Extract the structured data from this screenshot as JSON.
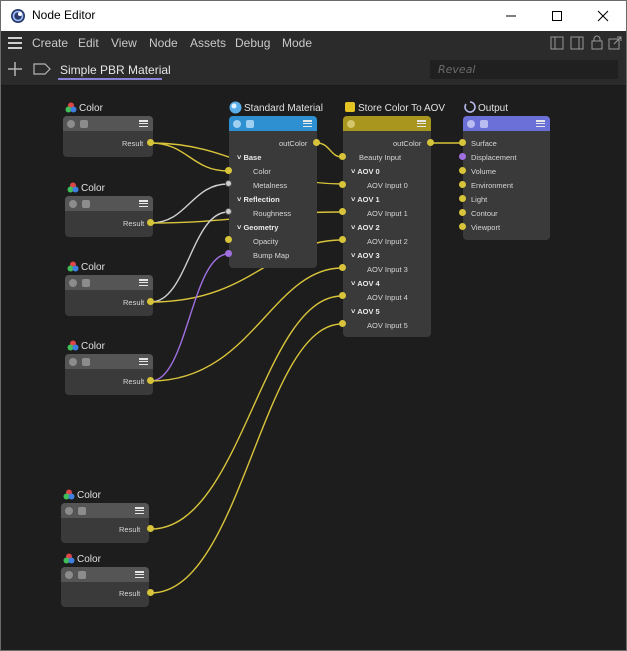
{
  "window": {
    "title": "Node Editor"
  },
  "menu": [
    "Create",
    "Edit",
    "View",
    "Node",
    "Assets",
    "Debug",
    "Mode"
  ],
  "tab": {
    "label": "Simple PBR Material"
  },
  "search": {
    "placeholder": "Reveal"
  },
  "colors": {
    "accent": "#8b84d6",
    "wire": "#d8c43a",
    "wire_light": "#c8c8c8",
    "wire_purple": "#a070e0",
    "standard_material": "#2e8fd1",
    "aov": "#a9961e",
    "output": "#6b6fd8"
  },
  "color_node": {
    "title": "Color",
    "output": "Result"
  },
  "standard_material": {
    "title": "Standard Material",
    "output": "outColor",
    "rows": [
      {
        "label": "Base",
        "group": true
      },
      {
        "label": "Color"
      },
      {
        "label": "Metalness"
      },
      {
        "label": "Reflection",
        "group": true
      },
      {
        "label": "Roughness"
      },
      {
        "label": "Geometry",
        "group": true
      },
      {
        "label": "Opacity"
      },
      {
        "label": "Bump Map"
      }
    ]
  },
  "store_color": {
    "title": "Store Color To AOV",
    "output": "outColor",
    "rows": [
      {
        "label": "Beauty Input"
      },
      {
        "label": "AOV 0",
        "group": true
      },
      {
        "label": "AOV Input 0"
      },
      {
        "label": "AOV 1",
        "group": true
      },
      {
        "label": "AOV Input 1"
      },
      {
        "label": "AOV 2",
        "group": true
      },
      {
        "label": "AOV Input 2"
      },
      {
        "label": "AOV 3",
        "group": true
      },
      {
        "label": "AOV Input 3"
      },
      {
        "label": "AOV 4",
        "group": true
      },
      {
        "label": "AOV Input 4"
      },
      {
        "label": "AOV 5",
        "group": true
      },
      {
        "label": "AOV Input 5"
      }
    ]
  },
  "output_node": {
    "title": "Output",
    "inputs": [
      "Surface",
      "Displacement",
      "Volume",
      "Environment",
      "Light",
      "Contour",
      "Viewport"
    ]
  }
}
